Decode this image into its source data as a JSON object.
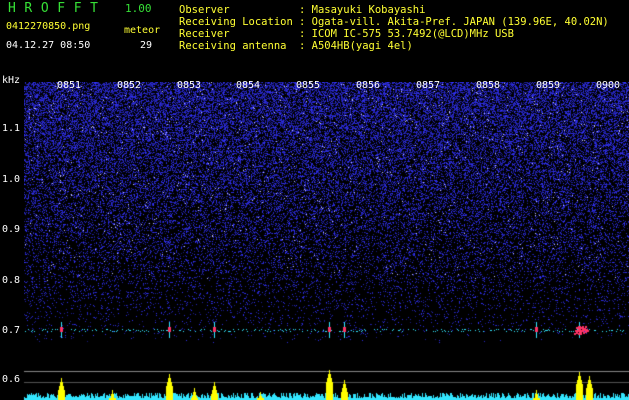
{
  "header": {
    "app_title": "HROFFT",
    "app_version": "1.00",
    "file_name": "0412270850.png",
    "datetime": "04.12.27 08:50",
    "meteor_label": "meteor",
    "meteor_count": "29"
  },
  "info": [
    {
      "label": "Observer",
      "value": ": Masayuki Kobayashi"
    },
    {
      "label": "Receiving Location",
      "value": ": Ogata-vill. Akita-Pref. JAPAN (139.96E, 40.02N)"
    },
    {
      "label": "Receiver",
      "value": ": ICOM IC-575 53.7492(@LCD)MHz USB"
    },
    {
      "label": "Receiving antenna",
      "value": ": A504HB(yagi 4el)"
    }
  ],
  "axis": {
    "unit": "kHz",
    "time_ticks": [
      "0851",
      "0852",
      "0853",
      "0854",
      "0855",
      "0856",
      "0857",
      "0858",
      "0859",
      "0900"
    ],
    "freq_ticks": [
      "1.1",
      "1.0",
      "0.9",
      "0.8",
      "0.7",
      "0.6"
    ]
  },
  "colors": {
    "background": "#000000",
    "noise": "#2a2ad0",
    "trace": "#33e6ff",
    "meteor": "#ff3366",
    "activity_fill": "#ffff00",
    "activity_base": "#33e6ff",
    "title_green": "#36e036"
  }
}
